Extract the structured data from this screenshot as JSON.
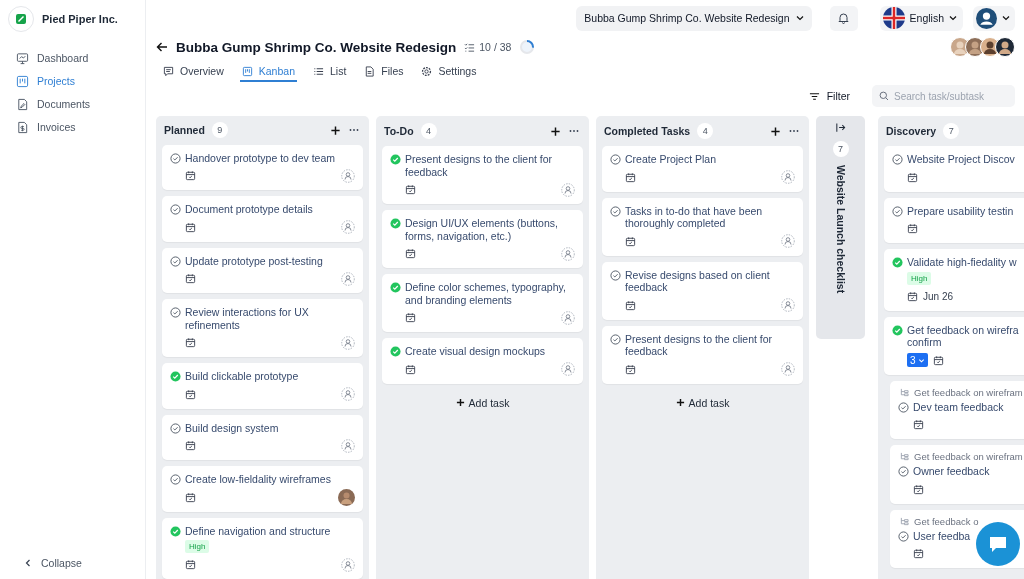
{
  "sidebar": {
    "brand": "Pied Piper Inc.",
    "items": [
      {
        "label": "Dashboard",
        "selected": false
      },
      {
        "label": "Projects",
        "selected": true
      },
      {
        "label": "Documents",
        "selected": false
      },
      {
        "label": "Invoices",
        "selected": false
      }
    ],
    "collapse": "Collapse"
  },
  "topbar": {
    "project": "Bubba Gump Shrimp Co. Website Redesign",
    "language": "English"
  },
  "header": {
    "title": "Bubba Gump Shrimp Co. Website Redesign",
    "task_count": "10 / 38",
    "progress": {
      "level": 0.26
    }
  },
  "tabs": [
    {
      "label": "Overview",
      "selected": false
    },
    {
      "label": "Kanban",
      "selected": true
    },
    {
      "label": "List",
      "selected": false
    },
    {
      "label": "Files",
      "selected": false
    },
    {
      "label": "Settings",
      "selected": false
    }
  ],
  "toolbar": {
    "filter": "Filter",
    "search_placeholder": "Search task/subtask"
  },
  "columns": [
    {
      "kind": "list",
      "title": "Planned",
      "count": "9",
      "actions": true,
      "tasks": [
        {
          "kind": "task",
          "title": "Handover prototype to dev team",
          "done": false,
          "assigned": false
        },
        {
          "kind": "task",
          "title": "Document prototype details",
          "done": false,
          "assigned": false
        },
        {
          "kind": "task",
          "title": "Update prototype post-testing",
          "done": false,
          "assigned": false
        },
        {
          "kind": "task",
          "title": "Review interactions for UX refinements",
          "done": false,
          "assigned": false
        },
        {
          "kind": "task",
          "title": "Build clickable prototype",
          "done": true,
          "assigned": false
        },
        {
          "kind": "task",
          "title": "Build design system",
          "done": false,
          "assigned": false
        },
        {
          "kind": "task",
          "title": "Create low-fieldality wireframes",
          "done": false,
          "assigned": true
        },
        {
          "kind": "task",
          "title": "Define navigation and structure",
          "done": true,
          "priority": "High",
          "assigned": false
        }
      ]
    },
    {
      "kind": "list",
      "title": "To-Do",
      "count": "4",
      "actions": true,
      "add_label": "Add task",
      "tasks": [
        {
          "kind": "task",
          "title": "Present designs to the client for feedback",
          "done": true,
          "assigned": false
        },
        {
          "kind": "task",
          "title": "Design UI/UX elements (buttons, forms, navigation, etc.)",
          "done": true,
          "assigned": false
        },
        {
          "kind": "task",
          "title": "Define color schemes, typography, and branding elements",
          "done": true,
          "assigned": false
        },
        {
          "kind": "task",
          "title": "Create visual design mockups",
          "done": true,
          "assigned": false
        }
      ]
    },
    {
      "kind": "list",
      "title": "Completed Tasks",
      "count": "4",
      "actions": true,
      "add_label": "Add task",
      "tasks": [
        {
          "kind": "task",
          "title": "Create Project Plan",
          "done": false,
          "assigned": false
        },
        {
          "kind": "task",
          "title": "Tasks in to-do that have been thoroughly completed",
          "done": false,
          "assigned": false
        },
        {
          "kind": "task",
          "title": "Revise designs based on client feedback",
          "done": false,
          "assigned": false
        },
        {
          "kind": "task",
          "title": "Present designs to the client for feedback",
          "done": false,
          "assigned": false
        }
      ]
    },
    {
      "kind": "collapsed",
      "title": "Website Launch checklist",
      "count": "7"
    },
    {
      "kind": "list",
      "title": "Discovery",
      "count": "7",
      "actions": false,
      "tasks": [
        {
          "kind": "task",
          "title": "Website Project Discov",
          "done": false
        },
        {
          "kind": "task",
          "title": "Prepare usability testin",
          "done": false
        },
        {
          "kind": "task",
          "title": "Validate high-fiedality w",
          "done": true,
          "priority": "High",
          "date": "Jun 26"
        },
        {
          "kind": "task",
          "title": "Get feedback on wirefra\nconfirm",
          "done": true,
          "subtasks": "3"
        },
        {
          "kind": "subtask",
          "parent": "Get feedback on wirefram",
          "title": "Dev team feedback",
          "done": false
        },
        {
          "kind": "subtask",
          "parent": "Get feedback on wirefram",
          "title": "Owner feedback",
          "done": false
        },
        {
          "kind": "subtask",
          "parent": "Get feedback o",
          "title": "User feedba",
          "done": false
        }
      ]
    }
  ]
}
